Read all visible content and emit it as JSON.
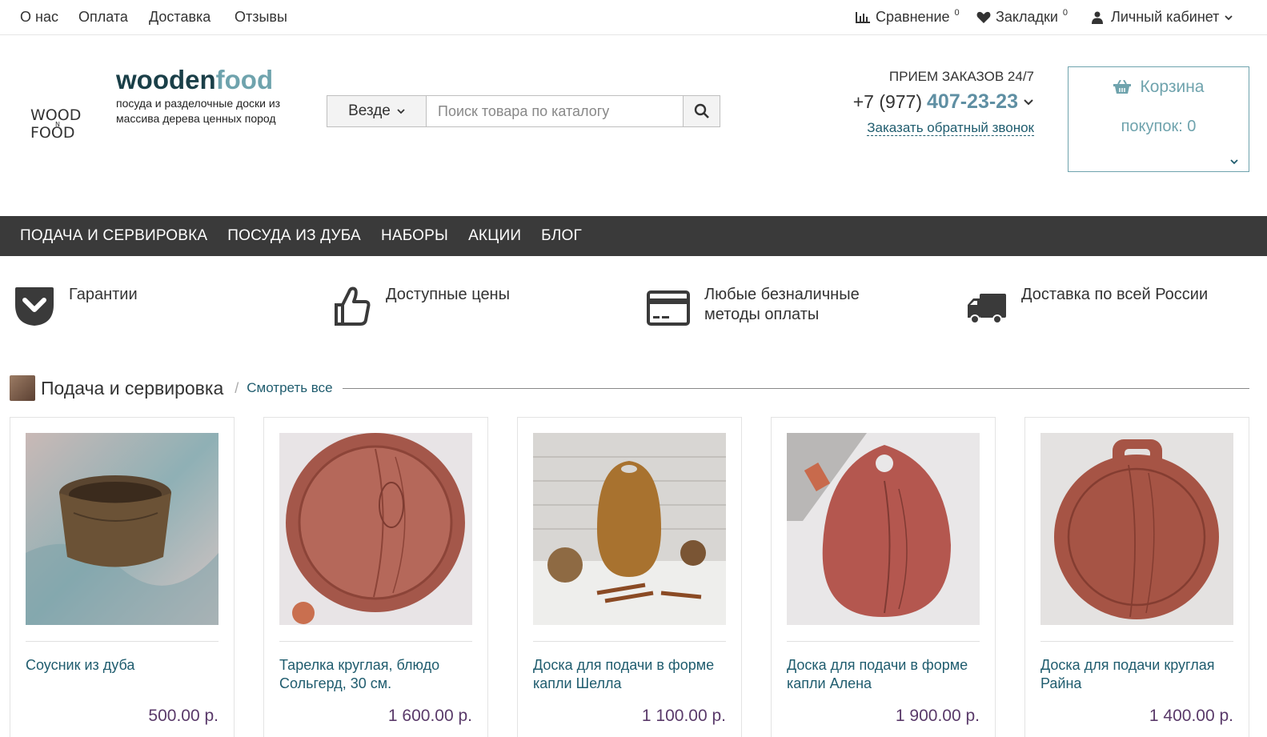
{
  "topbar": {
    "links": [
      "О нас",
      "Оплата",
      "Доставка",
      "Отзывы"
    ],
    "compare_label": "Сравнение",
    "compare_count": "0",
    "bookmarks_label": "Закладки",
    "bookmarks_count": "0",
    "account_label": "Личный кабинет"
  },
  "logo": {
    "line1": "WOOD",
    "line2": "N",
    "line3": "FOOD"
  },
  "brand": {
    "part1": "wooden",
    "part2": "food",
    "tagline": "посуда и разделочные доски из массива дерева ценных пород"
  },
  "search": {
    "scope": "Везде",
    "placeholder": "Поиск товара по каталогу"
  },
  "contacts": {
    "orders_label": "ПРИЕМ ЗАКАЗОВ 24/7",
    "phone_prefix": "+7 (977)",
    "phone_number": "407-23-23",
    "callback_label": "Заказать обратный звонок"
  },
  "cart": {
    "title": "Корзина",
    "summary": "покупок: 0"
  },
  "nav": [
    "ПОДАЧА И СЕРВИРОВКА",
    "ПОСУДА ИЗ ДУБА",
    "НАБОРЫ",
    "АКЦИИ",
    "БЛОГ"
  ],
  "features": [
    {
      "icon": "shield-check-icon",
      "text": "Гарантии"
    },
    {
      "icon": "thumbs-up-icon",
      "text": "Доступные цены"
    },
    {
      "icon": "credit-card-icon",
      "text": "Любые безналичные методы оплаты"
    },
    {
      "icon": "truck-icon",
      "text": "Доставка по всей России"
    }
  ],
  "section": {
    "title": "Подача и сервировка",
    "view_all": "Смотреть все"
  },
  "products": [
    {
      "name": "Соусник из дуба",
      "price": "500.00 р."
    },
    {
      "name": "Тарелка круглая, блюдо Сольгерд, 30 см.",
      "price": "1 600.00 р."
    },
    {
      "name": "Доска для подачи в форме капли Шелла",
      "price": "1 100.00 р."
    },
    {
      "name": "Доска для подачи в форме капли Алена",
      "price": "1 900.00 р."
    },
    {
      "name": "Доска для подачи круглая Райна",
      "price": "1 400.00 р."
    }
  ],
  "colors": {
    "brand_dark": "#1a3f48",
    "brand_light": "#6fa3ad",
    "nav_bg": "#3a3a3a",
    "link": "#1f5c6e",
    "price": "#5a3a6a"
  }
}
